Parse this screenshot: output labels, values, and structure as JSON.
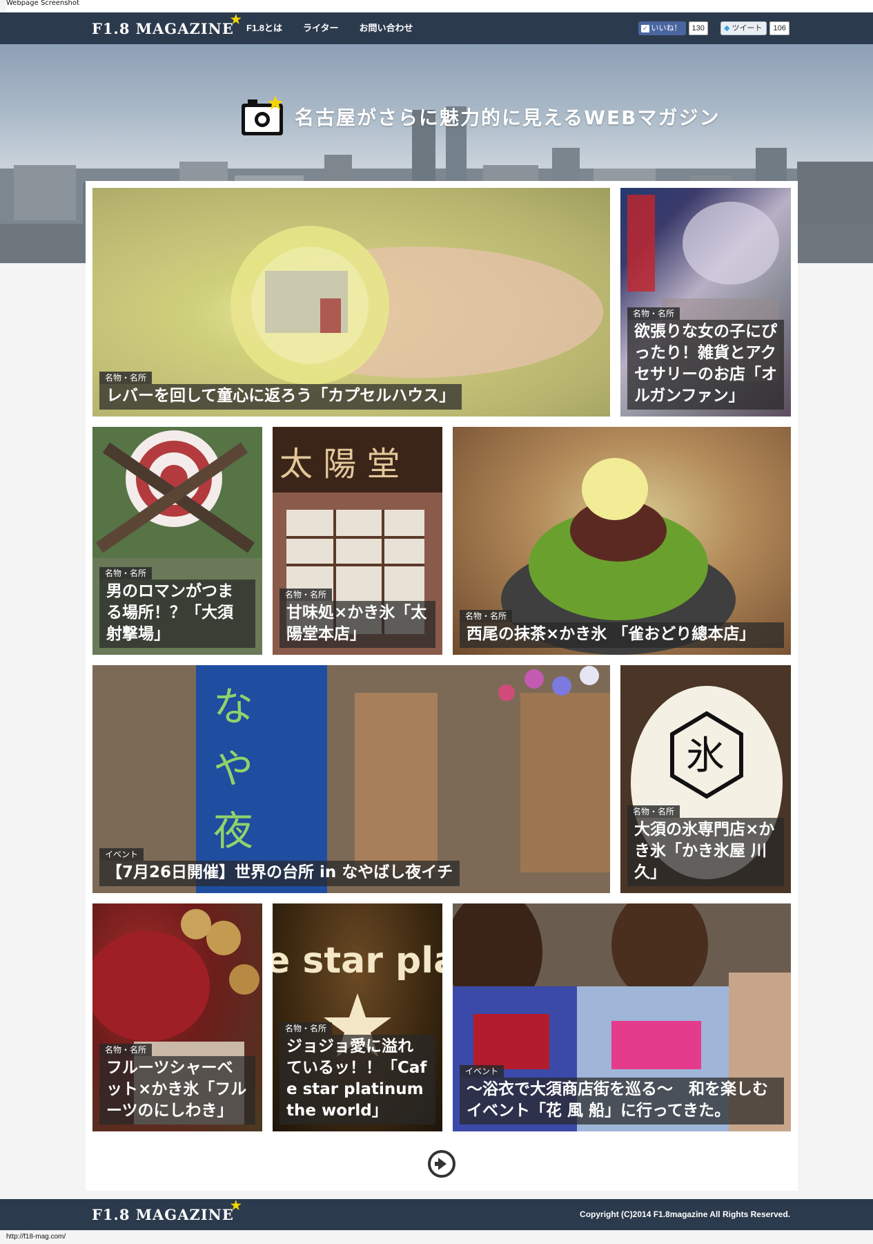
{
  "window": {
    "label": "Webpage Screenshot"
  },
  "header": {
    "logo": "F1.8 MAGAZINE",
    "nav": [
      "F1.8とは",
      "ライター",
      "お問い合わせ"
    ],
    "facebook": {
      "label": "いいね！",
      "count": "130"
    },
    "twitter": {
      "label": "ツイート",
      "count": "106"
    }
  },
  "hero": {
    "tagline": "名古屋がさらに魅力的に見えるWEBマガジン"
  },
  "articles": [
    {
      "category": "名物・名所",
      "title": "レバーを回して童心に返ろう「カプセルハウス」"
    },
    {
      "category": "名物・名所",
      "title": "欲張りな女の子にぴったり！雑貨とアクセサリーのお店「オルガンファン」"
    },
    {
      "category": "名物・名所",
      "title": "男のロマンがつまる場所！？「大須射撃場」"
    },
    {
      "category": "名物・名所",
      "title": "甘味処×かき氷「太陽堂本店」"
    },
    {
      "category": "名物・名所",
      "title": "西尾の抹茶×かき氷 「雀おどり總本店」"
    },
    {
      "category": "イベント",
      "title": "【7月26日開催】世界の台所 in なやばし夜イチ"
    },
    {
      "category": "名物・名所",
      "title": "大須の氷専門店×かき氷「かき氷屋 川久」"
    },
    {
      "category": "名物・名所",
      "title": "フルーツシャーベット×かき氷「フルーツのにしわき」"
    },
    {
      "category": "名物・名所",
      "title": "ジョジョ愛に溢れているッ！！「Cafe star platinum the world」"
    },
    {
      "category": "イベント",
      "title": "〜浴衣で大須商店街を巡る〜　和を楽しむイベント「花 風 船」に行ってきた。"
    }
  ],
  "footer": {
    "logo": "F1.8 MAGAZINE",
    "copyright": "Copyright (C)2014 F1.8magazine All Rights Reserved."
  },
  "status_url": "http://f18-mag.com/",
  "colors": {
    "nav_bg": "#2c3a4d",
    "accent": "#f5d400",
    "page_bg": "#f4f4f4"
  }
}
